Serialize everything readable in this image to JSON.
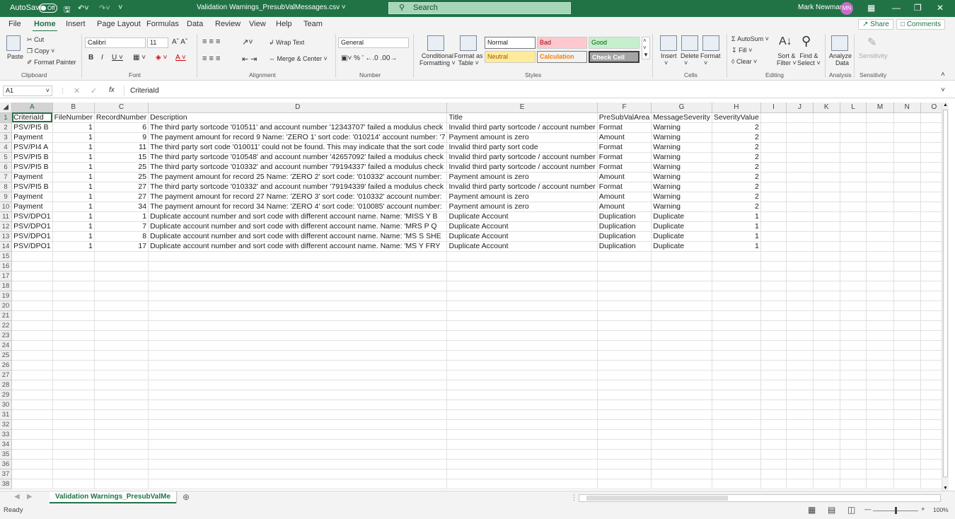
{
  "titlebar": {
    "autosave": "AutoSave",
    "toggle": "Off",
    "file_name": "Validation Warnings_PresubValMessages.csv",
    "search_placeholder": "Search",
    "user_name": "Mark Newman",
    "user_initials": "MN"
  },
  "tabs": [
    "File",
    "Home",
    "Insert",
    "Page Layout",
    "Formulas",
    "Data",
    "Review",
    "View",
    "Help",
    "Team"
  ],
  "share_label": "Share",
  "comments_label": "Comments",
  "ribbon": {
    "clipboard": {
      "paste": "Paste",
      "cut": "Cut",
      "copy": "Copy",
      "format_painter": "Format Painter",
      "group": "Clipboard"
    },
    "font": {
      "name": "Calibri",
      "size": "11",
      "group": "Font"
    },
    "alignment": {
      "wrap_text": "Wrap Text",
      "merge_center": "Merge & Center",
      "group": "Alignment"
    },
    "number": {
      "format": "General",
      "group": "Number"
    },
    "styles": {
      "conditional_1": "Conditional",
      "conditional_2": "Formatting",
      "format_table_1": "Format as",
      "format_table_2": "Table",
      "normal": "Normal",
      "bad": "Bad",
      "good": "Good",
      "neutral": "Neutral",
      "calculation": "Calculation",
      "check_cell": "Check Cell",
      "group": "Styles"
    },
    "cells": {
      "insert": "Insert",
      "delete": "Delete",
      "format": "Format",
      "group": "Cells"
    },
    "editing": {
      "autosum": "AutoSum",
      "fill": "Fill",
      "clear": "Clear",
      "sort_1": "Sort &",
      "sort_2": "Filter",
      "find_1": "Find &",
      "find_2": "Select",
      "group": "Editing"
    },
    "analysis": {
      "analyze_1": "Analyze",
      "analyze_2": "Data",
      "group": "Analysis"
    },
    "sensitivity": {
      "label": "Sensitivity",
      "group": "Sensitivity"
    }
  },
  "formula_bar": {
    "name_box": "A1",
    "fx": "fx",
    "content": "CriteriaId"
  },
  "columns": [
    "A",
    "B",
    "C",
    "D",
    "E",
    "F",
    "G",
    "H",
    "I",
    "J",
    "K",
    "L",
    "M",
    "N",
    "O"
  ],
  "rows": [
    [
      "CriteriaId",
      "FileNumber",
      "RecordNumber",
      "Description",
      "Title",
      "PreSubValArea",
      "MessageSeverity",
      "SeverityValue"
    ],
    [
      "PSV/PI5 B",
      "1",
      "6",
      "The third party sortcode '010511' and account number '12343707' failed a modulus check",
      "Invalid third party sortcode / account number",
      "Format",
      "Warning",
      "2"
    ],
    [
      "Payment",
      "1",
      "9",
      "The payment amount for record 9 Name: 'ZERO 1' sort code: '010214' account number: '7",
      "Payment amount is zero",
      "Amount",
      "Warning",
      "2"
    ],
    [
      "PSV/PI4 A",
      "1",
      "11",
      "The third party sort code '010011' could not be found. This may indicate that the sort code",
      "Invalid third party sort code",
      "Format",
      "Warning",
      "2"
    ],
    [
      "PSV/PI5 B",
      "1",
      "15",
      "The third party sortcode '010548' and account number '42657092' failed a modulus check",
      "Invalid third party sortcode / account number",
      "Format",
      "Warning",
      "2"
    ],
    [
      "PSV/PI5 B",
      "1",
      "25",
      "The third party sortcode '010332' and account number '79194337' failed a modulus check",
      "Invalid third party sortcode / account number",
      "Format",
      "Warning",
      "2"
    ],
    [
      "Payment",
      "1",
      "25",
      "The payment amount for record 25 Name: 'ZERO 2' sort code: '010332' account number:",
      "Payment amount is zero",
      "Amount",
      "Warning",
      "2"
    ],
    [
      "PSV/PI5 B",
      "1",
      "27",
      "The third party sortcode '010332' and account number '79194339' failed a modulus check",
      "Invalid third party sortcode / account number",
      "Format",
      "Warning",
      "2"
    ],
    [
      "Payment",
      "1",
      "27",
      "The payment amount for record 27 Name: 'ZERO 3' sort code: '010332' account number:",
      "Payment amount is zero",
      "Amount",
      "Warning",
      "2"
    ],
    [
      "Payment",
      "1",
      "34",
      "The payment amount for record 34 Name: 'ZERO 4' sort code: '010085' account number:",
      "Payment amount is zero",
      "Amount",
      "Warning",
      "2"
    ],
    [
      "PSV/DPO1",
      "1",
      "1",
      "Duplicate account number and sort code with different account name. Name: 'MISS Y B",
      "Duplicate Account",
      "Duplication",
      "Duplicate",
      "1"
    ],
    [
      "PSV/DPO1",
      "1",
      "7",
      "Duplicate account number and sort code with different account name. Name: 'MRS P Q",
      "Duplicate Account",
      "Duplication",
      "Duplicate",
      "1"
    ],
    [
      "PSV/DPO1",
      "1",
      "8",
      "Duplicate account number and sort code with different account name. Name: 'MS S SHE",
      "Duplicate Account",
      "Duplication",
      "Duplicate",
      "1"
    ],
    [
      "PSV/DPO1",
      "1",
      "17",
      "Duplicate account number and sort code with different account name. Name: 'MS Y FRY",
      "Duplicate Account",
      "Duplication",
      "Duplicate",
      "1"
    ]
  ],
  "row_count": 38,
  "sheet_tab": "Validation Warnings_PresubValMe",
  "status": {
    "ready": "Ready",
    "zoom": "100%"
  }
}
